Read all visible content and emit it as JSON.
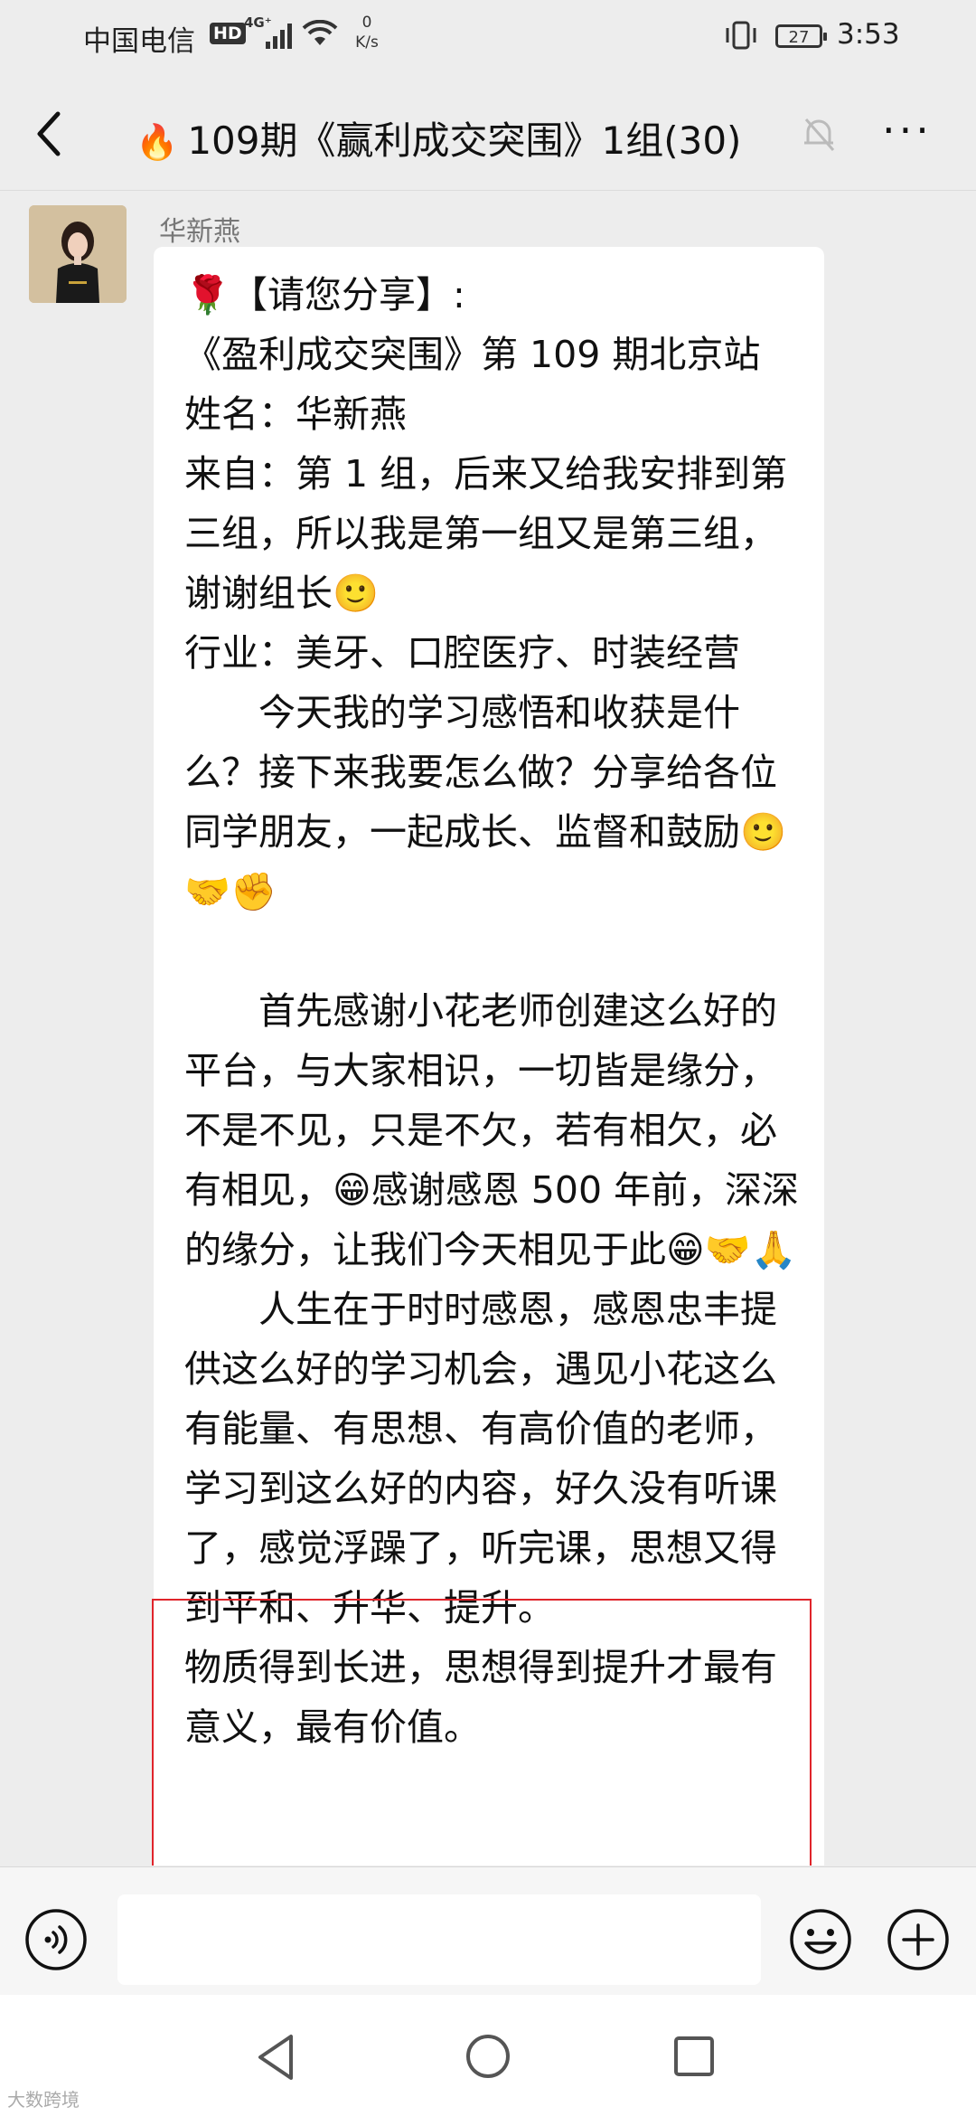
{
  "status_bar": {
    "carrier": "中国电信",
    "hd": "HD",
    "network": "4G⁺",
    "speed_value": "0",
    "speed_unit": "K/s",
    "battery": "27",
    "time": "3:53"
  },
  "header": {
    "emoji": "🔥",
    "title": "109期《赢利成交突围》1组(30)",
    "more": "···"
  },
  "message": {
    "sender": "华新燕",
    "text": "🌹【请您分享】:\n《盈利成交突围》第 109 期北京站\n姓名：华新燕\n来自：第 1 组，后来又给我安排到第三组，所以我是第一组又是第三组，谢谢组长🙂\n行业：美牙、口腔医疗、时装经营\n　　今天我的学习感悟和收获是什么？接下来我要怎么做？分享给各位同学朋友，一起成长、监督和鼓励🙂🤝✊\n\n　　首先感谢小花老师创建这么好的平台，与大家相识，一切皆是缘分，不是不见，只是不欠，若有相欠，必有相见，😁感谢感恩 500 年前，深深的缘分，让我们今天相见于此😁🤝🙏\n　　人生在于时时感恩，感恩忠丰提供这么好的学习机会，遇见小花这么有能量、有思想、有高价值的老师，学习到这么好的内容，好久没有听课了，感觉浮躁了，听完课，思想又得到平和、升华、提升。\n物质得到长进，思想得到提升才最有意义，最有价值。"
  },
  "input_bar": {
    "placeholder": ""
  },
  "watermark": "大数跨境"
}
